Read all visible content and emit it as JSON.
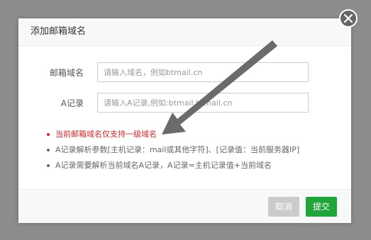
{
  "dialog": {
    "title": "添加邮箱域名"
  },
  "form": {
    "domain": {
      "label": "邮箱域名",
      "placeholder": "请输入域名，例如btmail.cn",
      "value": ""
    },
    "a_record": {
      "label": "A记录",
      "placeholder": "请输入A记录,例如:btmail.btmail.cn",
      "value": ""
    }
  },
  "tips": [
    {
      "text": "当前邮箱域名仅支持一级域名",
      "color": "#e02020"
    },
    {
      "text": "A记录解析参数[主机记录：mail或其他字符]、[记录值：当前服务器IP]",
      "color": "#666666"
    },
    {
      "text": "A记录需要解析当前域名A记录，A记录=主机记录值+当前域名",
      "color": "#666666"
    }
  ],
  "footer": {
    "cancel_label": "取消",
    "submit_label": "提交"
  },
  "icons": {
    "close": "close-icon",
    "arrow": "arrow-annotation"
  },
  "colors": {
    "primary": "#20a53a",
    "warning": "#e02020",
    "cancel": "#cbcbcb"
  }
}
